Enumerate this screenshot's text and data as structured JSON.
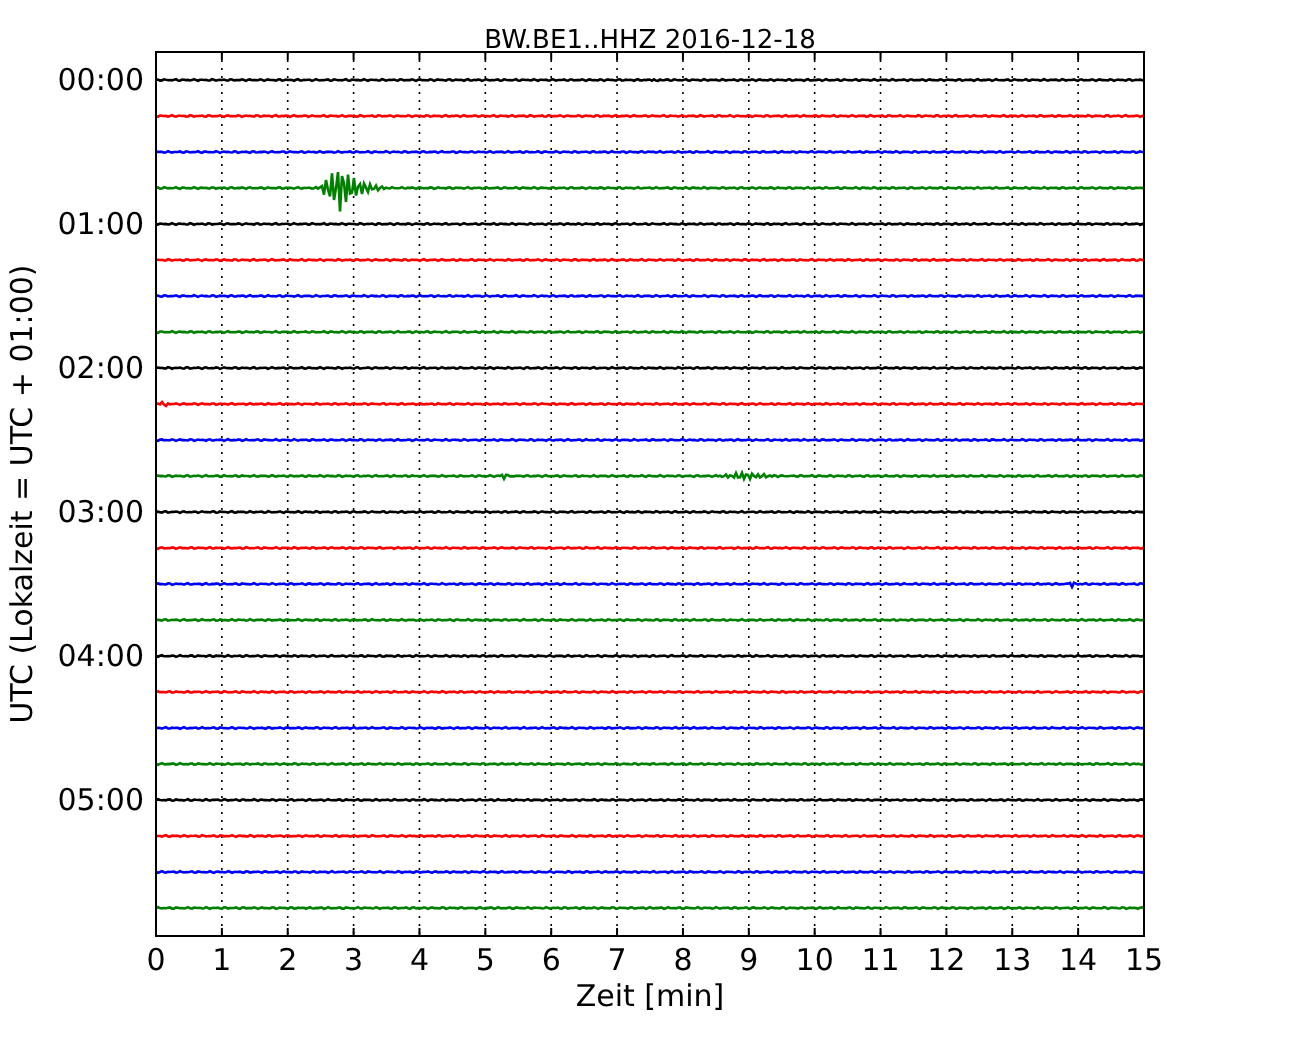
{
  "plot": {
    "title": "BW.BE1..HHZ 2016-12-18",
    "xlabel": "Zeit  [min]",
    "ylabel": "UTC (Lokalzeit = UTC + 01:00)",
    "xticks": [
      "0",
      "1",
      "2",
      "3",
      "4",
      "5",
      "6",
      "7",
      "8",
      "9",
      "10",
      "11",
      "12",
      "13",
      "14",
      "15"
    ],
    "yticks": [
      "00:00",
      "01:00",
      "02:00",
      "03:00",
      "04:00",
      "05:00"
    ],
    "traces": [
      {
        "color": "#000000"
      },
      {
        "color": "#ff0000"
      },
      {
        "color": "#0000ff"
      },
      {
        "color": "#008000"
      },
      {
        "color": "#000000"
      },
      {
        "color": "#ff0000"
      },
      {
        "color": "#0000ff"
      },
      {
        "color": "#008000"
      },
      {
        "color": "#000000"
      },
      {
        "color": "#ff0000"
      },
      {
        "color": "#0000ff"
      },
      {
        "color": "#008000"
      },
      {
        "color": "#000000"
      },
      {
        "color": "#ff0000"
      },
      {
        "color": "#0000ff"
      },
      {
        "color": "#008000"
      },
      {
        "color": "#000000"
      },
      {
        "color": "#ff0000"
      },
      {
        "color": "#0000ff"
      },
      {
        "color": "#008000"
      },
      {
        "color": "#000000"
      },
      {
        "color": "#ff0000"
      },
      {
        "color": "#0000ff"
      },
      {
        "color": "#008000"
      }
    ]
  }
}
